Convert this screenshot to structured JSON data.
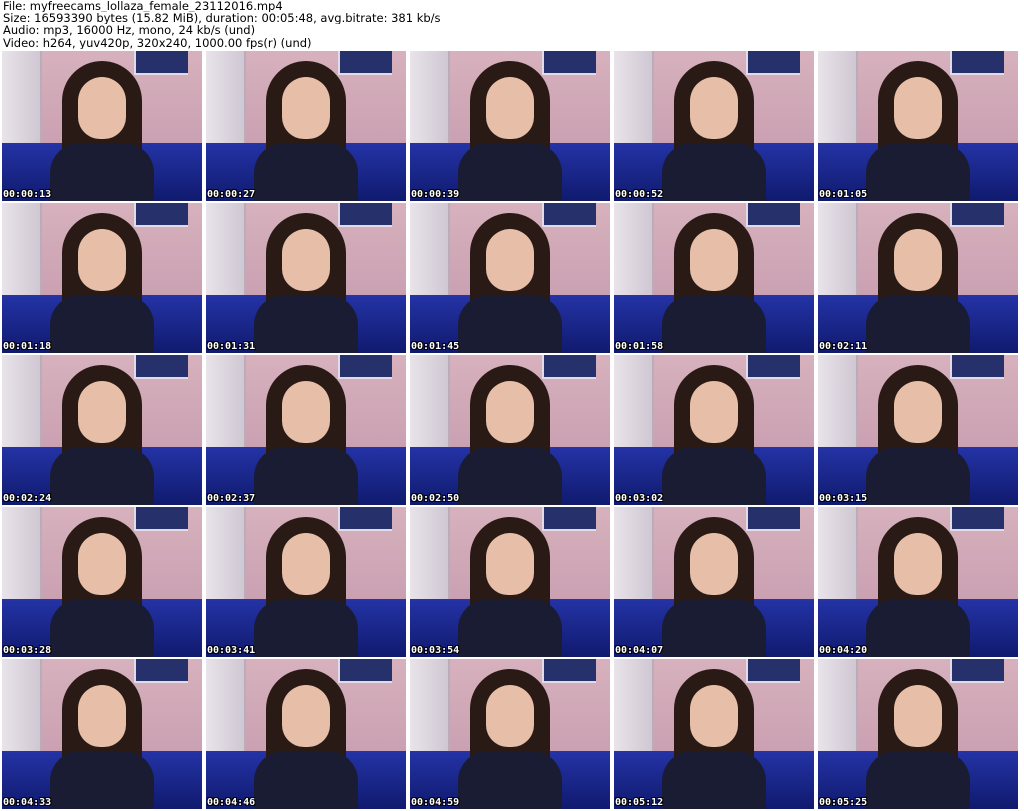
{
  "header": {
    "file": "File: myfreecams_lollaza_female_23112016.mp4",
    "size": "Size: 16593390 bytes (15.82 MiB), duration: 00:05:48, avg.bitrate: 381 kb/s",
    "audio": "Audio: mp3, 16000 Hz, mono, 24 kb/s (und)",
    "video": "Video: h264, yuv420p, 320x240, 1000.00 fps(r) (und)"
  },
  "thumbnails": [
    "00:00:13",
    "00:00:27",
    "00:00:39",
    "00:00:52",
    "00:01:05",
    "00:01:18",
    "00:01:31",
    "00:01:45",
    "00:01:58",
    "00:02:11",
    "00:02:24",
    "00:02:37",
    "00:02:50",
    "00:03:02",
    "00:03:15",
    "00:03:28",
    "00:03:41",
    "00:03:54",
    "00:04:07",
    "00:04:20",
    "00:04:33",
    "00:04:46",
    "00:04:59",
    "00:05:12",
    "00:05:25"
  ]
}
